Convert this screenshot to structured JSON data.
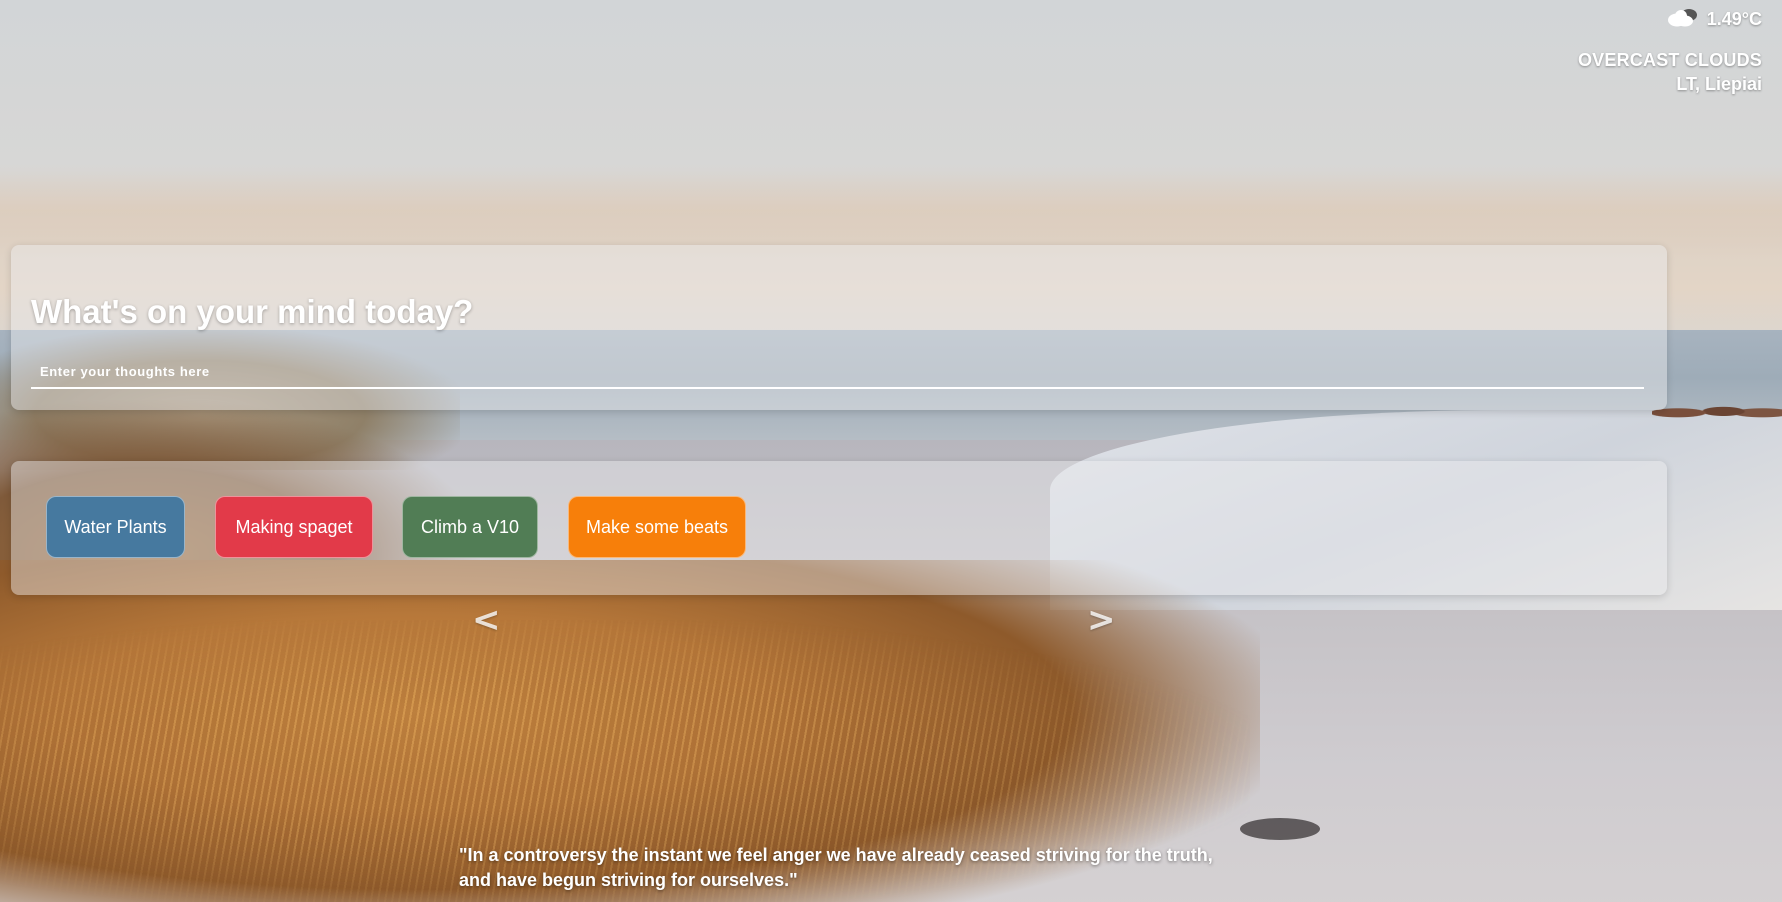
{
  "weather": {
    "icon": "cloud-icon",
    "temperature": "1.49°C",
    "description": "OVERCAST CLOUDS",
    "location": "LT, Liepiai"
  },
  "mind": {
    "title": "What's on your mind today?",
    "placeholder": "Enter your thoughts here"
  },
  "tasks": [
    {
      "label": "Water Plants",
      "color": "#46799f"
    },
    {
      "label": "Making spaget",
      "color": "#e23a49"
    },
    {
      "label": "Climb a V10",
      "color": "#517d55"
    },
    {
      "label": "Make some beats",
      "color": "#f77f0a"
    }
  ],
  "nav": {
    "prev": "<",
    "next": ">"
  },
  "quote": "\"In a controversy the instant we feel anger we have already ceased striving for the truth, and have begun striving for ourselves.\""
}
